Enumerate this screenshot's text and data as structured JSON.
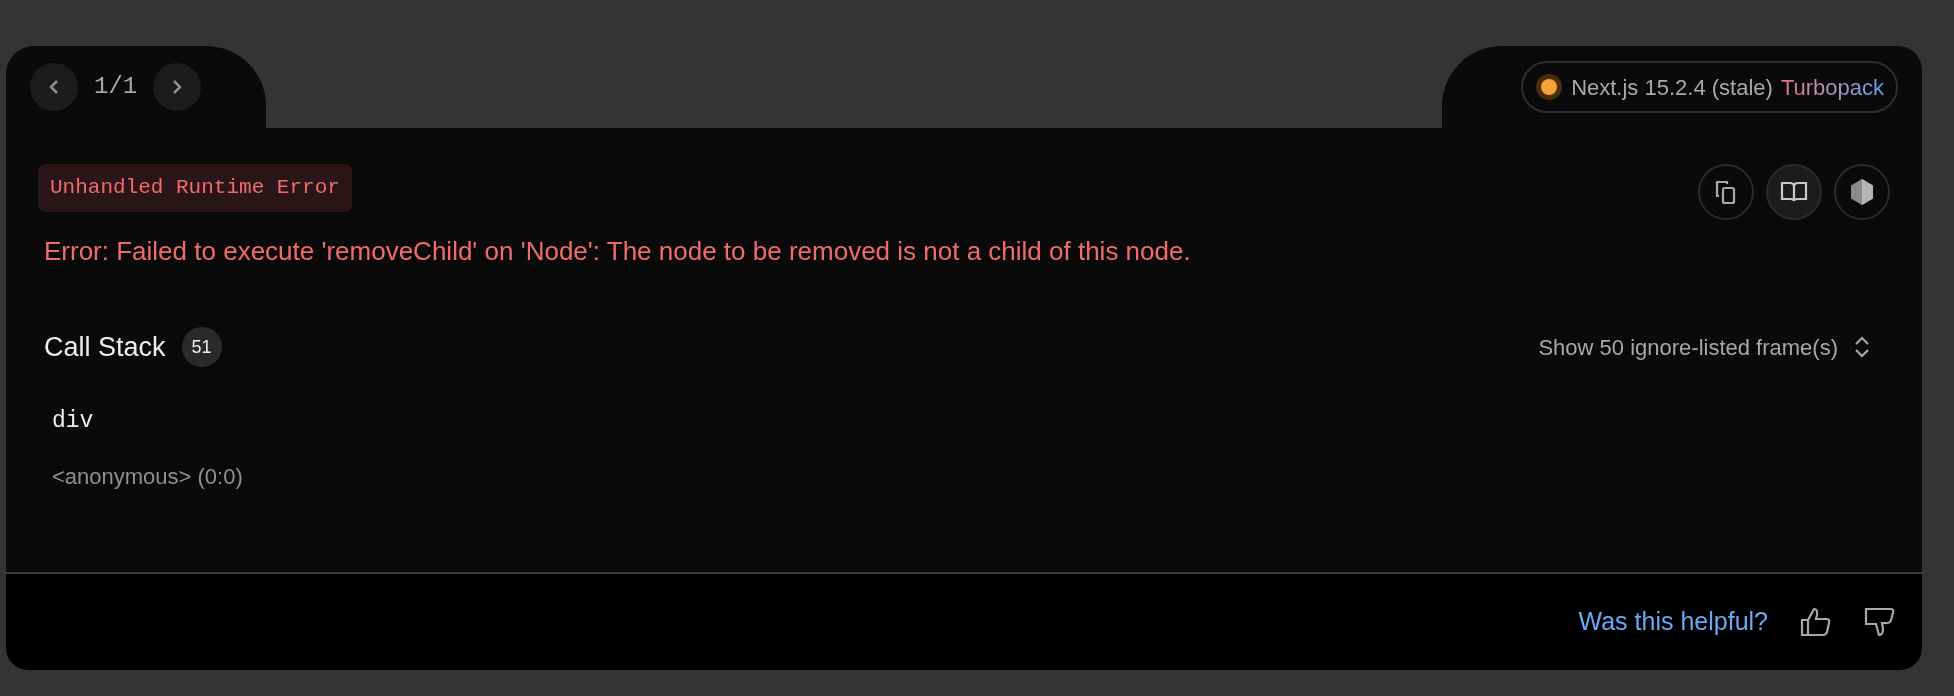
{
  "pager": {
    "counter": "1/1"
  },
  "version": {
    "label": "Next.js 15.2.4 (stale)",
    "bundler": "Turbopack"
  },
  "error_type": "Unhandled Runtime Error",
  "message": "Error: Failed to execute 'removeChild' on 'Node': The node to be removed is not a child of this node.",
  "call_stack": {
    "title": "Call Stack",
    "count": "51",
    "toggle": "Show 50 ignore-listed frame(s)"
  },
  "frames": [
    {
      "name": "div",
      "location": "<anonymous> (0:0)"
    }
  ],
  "footer": {
    "question": "Was this helpful?"
  }
}
